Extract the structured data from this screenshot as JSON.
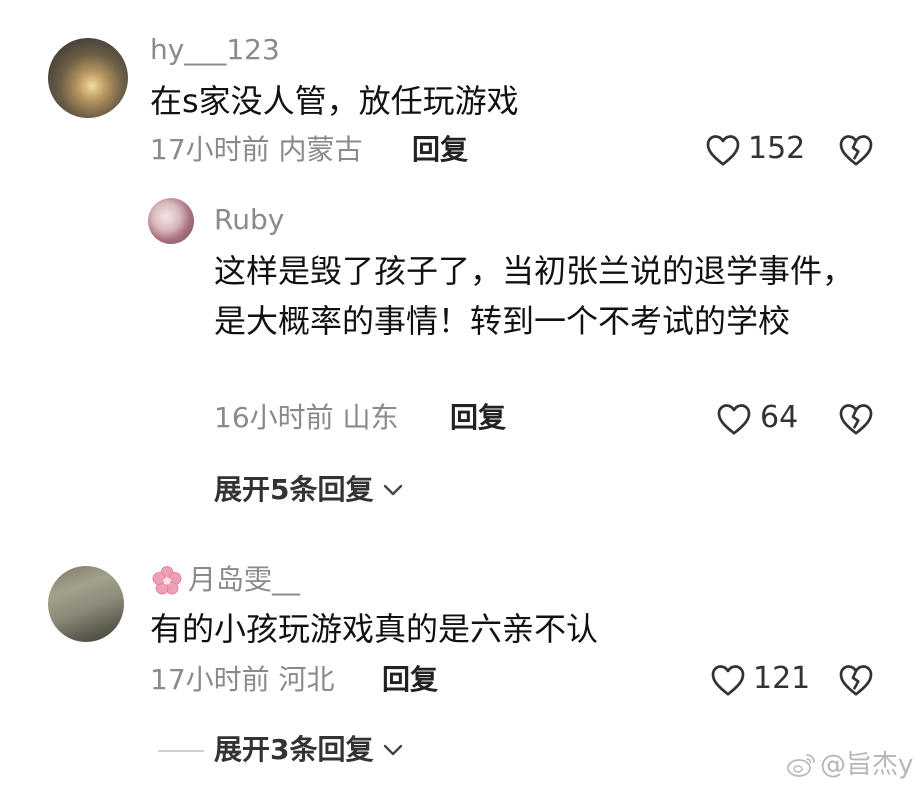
{
  "comments": [
    {
      "username": "hy___123",
      "text": "在s家没人管，放任玩游戏",
      "time": "17小时前",
      "location": "内蒙古",
      "reply_label": "回复",
      "likes": "152"
    },
    {
      "username": "Ruby",
      "text": "这样是毁了孩子了，当初张兰说的退学事件，是大概率的事情！转到一个不考试的学校",
      "time": "16小时前",
      "location": "山东",
      "reply_label": "回复",
      "likes": "64"
    },
    {
      "username": "月岛雯__",
      "text": "有的小孩玩游戏真的是六亲不认",
      "time": "17小时前",
      "location": "河北",
      "reply_label": "回复",
      "likes": "121"
    }
  ],
  "expand": [
    {
      "label": "展开5条回复"
    },
    {
      "label": "展开3条回复"
    }
  ],
  "watermark": "@旨杰y",
  "icons": {
    "like": "heart-outline-icon",
    "dislike": "broken-heart-icon",
    "expand": "chevron-down-icon",
    "name_prefix": "sakura-flower-icon",
    "watermark": "weibo-logo-icon"
  },
  "colors": {
    "text": "#111111",
    "meta": "#8a8a8a",
    "divider": "#d0d0d0",
    "flower": "#f0a0b4"
  }
}
